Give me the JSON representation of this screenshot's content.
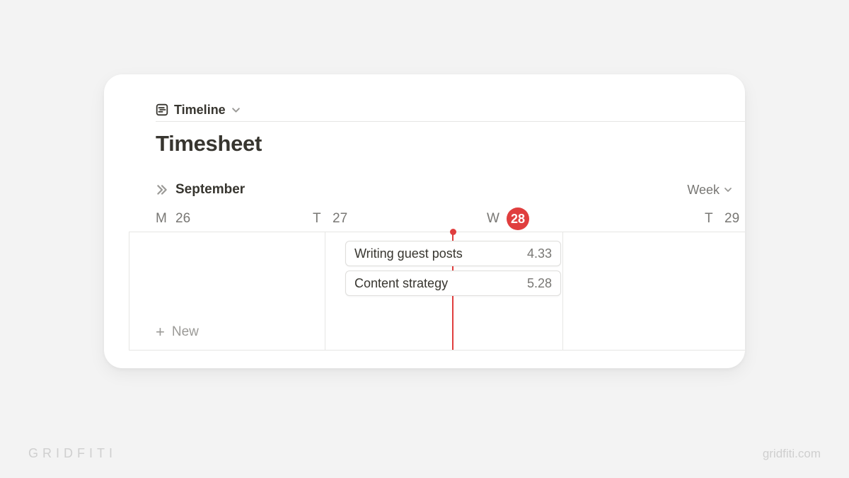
{
  "view": {
    "label": "Timeline",
    "zoom": "Week"
  },
  "title": "Timesheet",
  "month": "September",
  "days": [
    {
      "dow": "M",
      "num": "26",
      "today": false
    },
    {
      "dow": "T",
      "num": "27",
      "today": false
    },
    {
      "dow": "W",
      "num": "28",
      "today": true
    },
    {
      "dow": "T",
      "num": "29",
      "today": false
    }
  ],
  "tasks": [
    {
      "title": "Writing guest posts",
      "hours": "4.33"
    },
    {
      "title": "Content strategy",
      "hours": "5.28"
    }
  ],
  "actions": {
    "new": "New"
  },
  "footer": {
    "brand": "GRIDFITI",
    "url": "gridfiti.com"
  },
  "colors": {
    "accent": "#e03e3e"
  }
}
